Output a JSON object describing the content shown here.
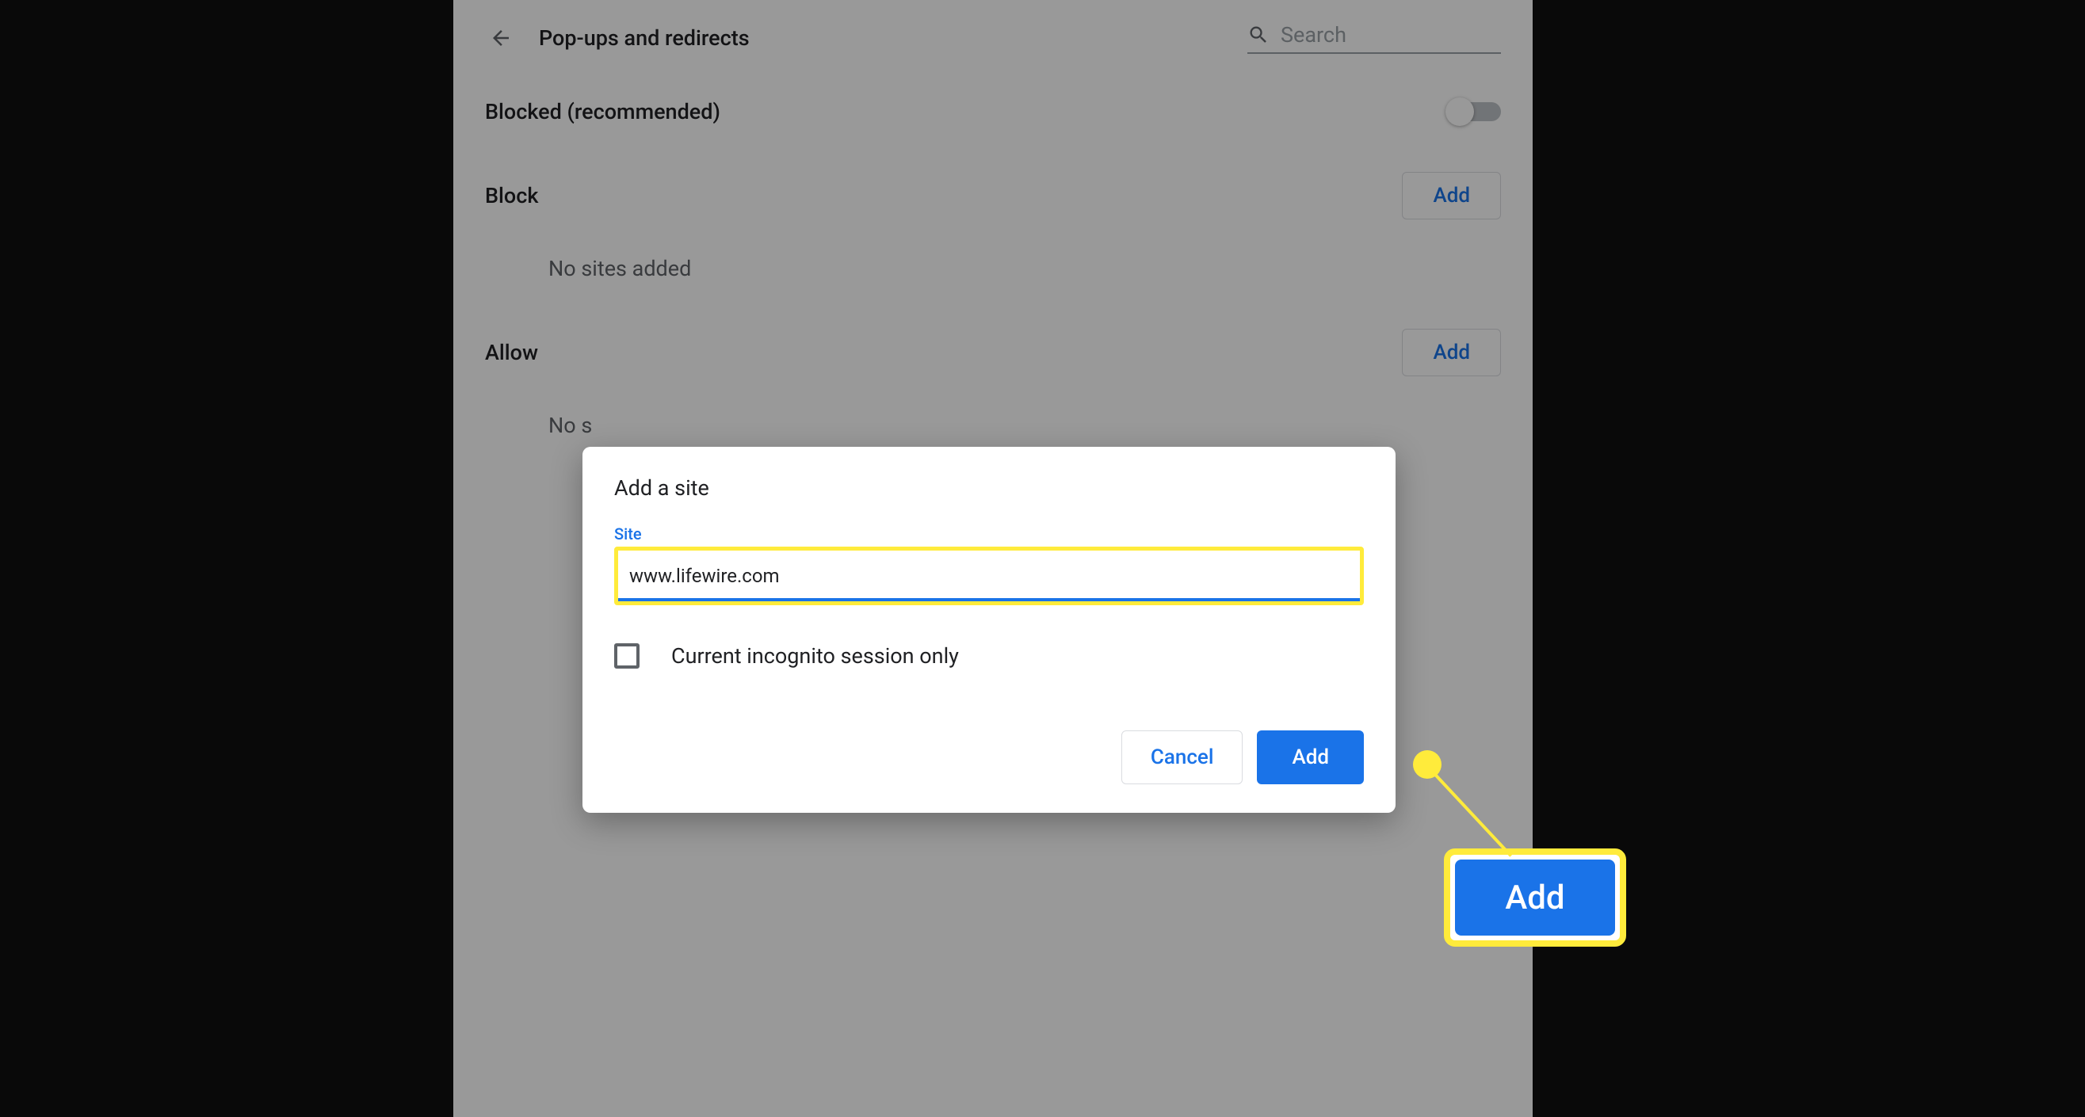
{
  "header": {
    "title": "Pop-ups and redirects",
    "search_placeholder": "Search"
  },
  "blocked": {
    "label": "Blocked (recommended)"
  },
  "block": {
    "label": "Block",
    "add": "Add",
    "empty": "No sites added"
  },
  "allow": {
    "label": "Allow",
    "add": "Add",
    "empty_partial": "No s"
  },
  "dialog": {
    "title": "Add a site",
    "site_label": "Site",
    "site_value": "www.lifewire.com",
    "checkbox_label": "Current incognito session only",
    "cancel": "Cancel",
    "add": "Add"
  },
  "callout": {
    "label": "Add"
  }
}
